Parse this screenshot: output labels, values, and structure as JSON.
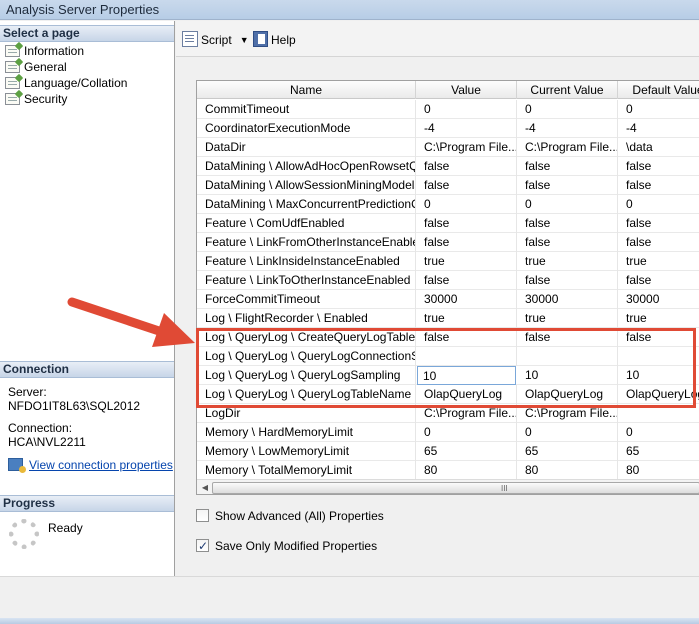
{
  "window": {
    "title": "Analysis Server Properties"
  },
  "left_pane": {
    "select_page_header": "Select a page",
    "pages": [
      "Information",
      "General",
      "Language/Collation",
      "Security"
    ],
    "connection_header": "Connection",
    "server_label": "Server:",
    "server_value": "NFDO1IT8L63\\SQL2012",
    "connection_label": "Connection:",
    "connection_value": "HCA\\NVL2211",
    "view_connection_link": "View connection properties",
    "progress_header": "Progress",
    "progress_status": "Ready"
  },
  "toolbar": {
    "script_label": "Script",
    "help_label": "Help"
  },
  "grid": {
    "columns": [
      "Name",
      "Value",
      "Current Value",
      "Default Value"
    ],
    "rows": [
      [
        "CommitTimeout",
        "0",
        "0",
        "0"
      ],
      [
        "CoordinatorExecutionMode",
        "-4",
        "-4",
        "-4"
      ],
      [
        "DataDir",
        "C:\\Program File...",
        "C:\\Program File...",
        "\\data"
      ],
      [
        "DataMining \\ AllowAdHocOpenRowsetQ...",
        "false",
        "false",
        "false"
      ],
      [
        "DataMining \\ AllowSessionMiningModels",
        "false",
        "false",
        "false"
      ],
      [
        "DataMining \\ MaxConcurrentPredictionQ...",
        "0",
        "0",
        "0"
      ],
      [
        "Feature \\ ComUdfEnabled",
        "false",
        "false",
        "false"
      ],
      [
        "Feature \\ LinkFromOtherInstanceEnabled",
        "false",
        "false",
        "false"
      ],
      [
        "Feature \\ LinkInsideInstanceEnabled",
        "true",
        "true",
        "true"
      ],
      [
        "Feature \\ LinkToOtherInstanceEnabled",
        "false",
        "false",
        "false"
      ],
      [
        "ForceCommitTimeout",
        "30000",
        "30000",
        "30000"
      ],
      [
        "Log \\ FlightRecorder \\ Enabled",
        "true",
        "true",
        "true"
      ],
      [
        "Log \\ QueryLog \\ CreateQueryLogTable",
        "false",
        "false",
        "false"
      ],
      [
        "Log \\ QueryLog \\ QueryLogConnectionS...",
        "",
        "",
        ""
      ],
      [
        "Log \\ QueryLog \\ QueryLogSampling",
        "10",
        "10",
        "10"
      ],
      [
        "Log \\ QueryLog \\ QueryLogTableName",
        "OlapQueryLog",
        "OlapQueryLog",
        "OlapQueryLog"
      ],
      [
        "LogDir",
        "C:\\Program File...",
        "C:\\Program File...",
        ""
      ],
      [
        "Memory \\ HardMemoryLimit",
        "0",
        "0",
        "0"
      ],
      [
        "Memory \\ LowMemoryLimit",
        "65",
        "65",
        "65"
      ],
      [
        "Memory \\ TotalMemoryLimit",
        "80",
        "80",
        "80"
      ]
    ],
    "editing_row": 14,
    "scroll_grip": "III"
  },
  "options": {
    "show_advanced_label": "Show Advanced (All) Properties",
    "show_advanced_checked": false,
    "save_modified_label": "Save Only Modified Properties",
    "save_modified_checked": true
  },
  "annotation_color": "#e04a35"
}
